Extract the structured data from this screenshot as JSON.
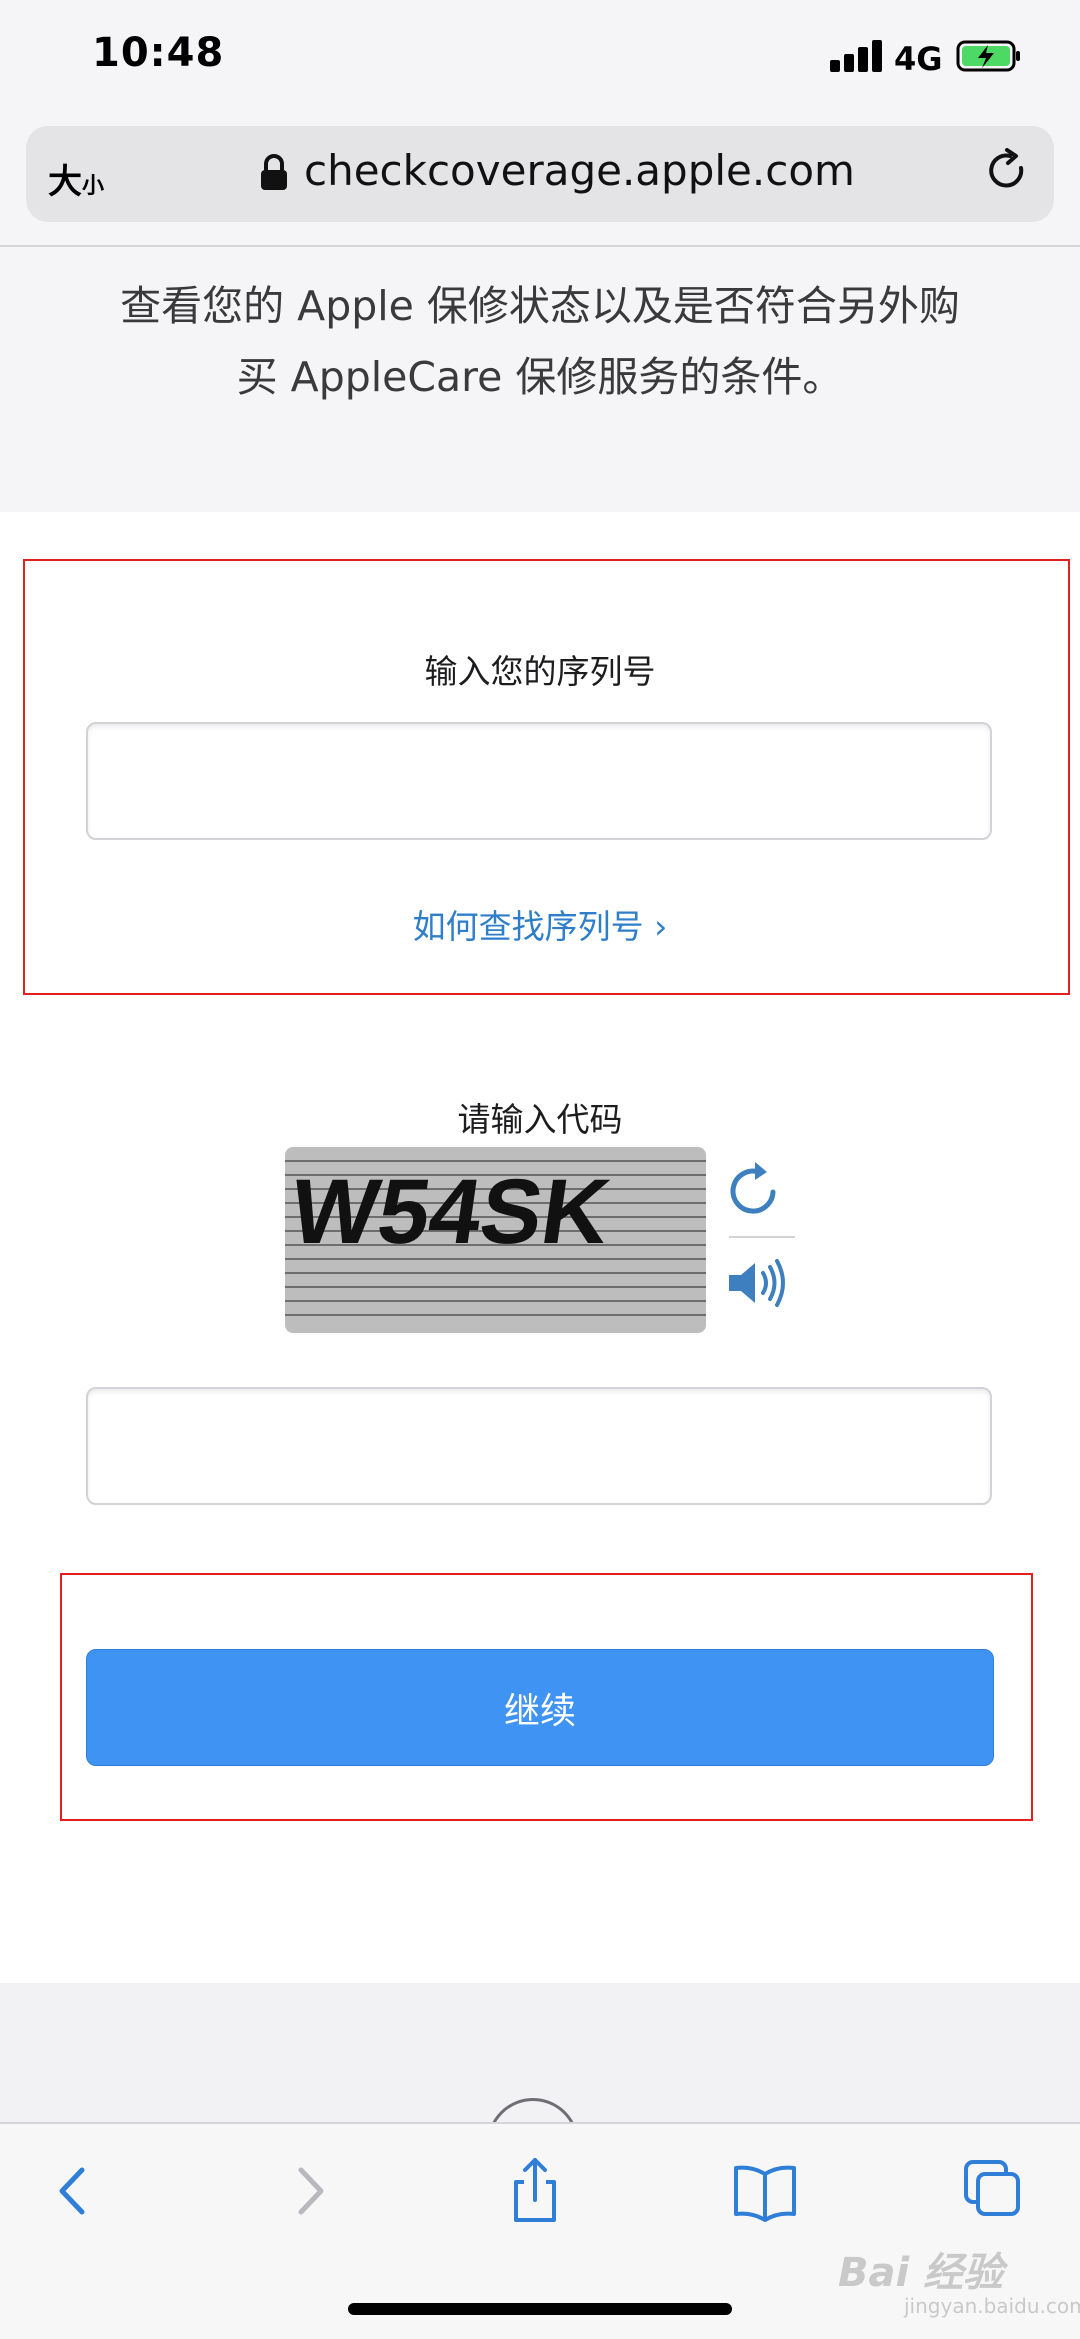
{
  "status_bar": {
    "time": "10:48",
    "network": "4G",
    "battery_color": "#4cd964"
  },
  "browser": {
    "text_size_label_large": "大",
    "text_size_label_small": "小",
    "url": "checkcoverage.apple.com"
  },
  "intro": {
    "line1": "查看您的 Apple 保修状态以及是否符合另外购",
    "line2": "买 AppleCare 保修服务的条件。"
  },
  "form": {
    "serial_label": "输入您的序列号",
    "serial_value": "",
    "find_serial_link": "如何查找序列号 ›",
    "code_label": "请输入代码",
    "captcha_text": "W54SK",
    "code_value": "",
    "continue_label": "继续"
  },
  "colors": {
    "accent": "#3f93f2",
    "link": "#2e7ec9",
    "highlight": "#e31f1f"
  },
  "watermark": {
    "text": "Bai 经验",
    "subtext": "jingyan.baidu.com"
  },
  "toolbar": {
    "icons": [
      "back-icon",
      "forward-icon",
      "share-icon",
      "bookmarks-icon",
      "tabs-icon"
    ]
  }
}
